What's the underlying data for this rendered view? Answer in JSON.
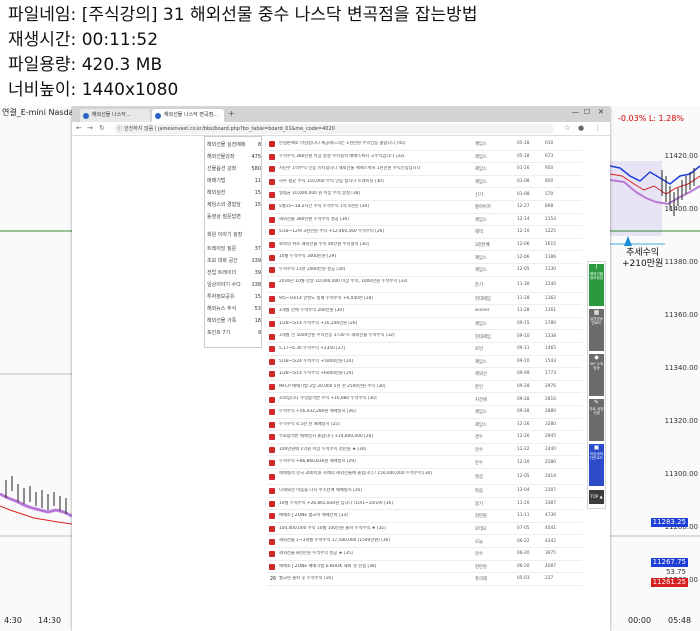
{
  "meta": [
    {
      "key": "파일네임: ",
      "value": "[주식강의] 31 해외선물 중수 나스닥 변곡점을 잡는방법"
    },
    {
      "key": "재생시간: ",
      "value": "00:11:52"
    },
    {
      "key": "파일용량: ",
      "value": "420.3 MB"
    },
    {
      "key": "너비높이: ",
      "value": "1440x1080"
    }
  ],
  "chart": {
    "title": "연결_E-mini Nasdaq100-20",
    "pct_change": "-0.03% L: 1.28%",
    "annotation_line1": "추세수익",
    "annotation_line2": "+210만원",
    "x_labels": [
      "4:30",
      "14:30",
      "00:00",
      "05:48"
    ],
    "y_labels": [
      "11420.00",
      "11400.00",
      "11380.00",
      "11360.00",
      "11340.00",
      "11320.00",
      "11300.00",
      "11280.00",
      "11260.00"
    ],
    "price_boxes": [
      "11283.25",
      "11267.75",
      "53.75",
      "11261.25"
    ],
    "colors": {
      "up": "#1d3fd6",
      "down": "#d42020",
      "band": "#b77ad6"
    }
  },
  "browser": {
    "tab1": "해외선물 나스닥...",
    "tab2": "해외선물 나스닥 변곡점...",
    "url": "jamesinvest.co.kr/bbs/board.php?bo_table=board_01&me_code=4020",
    "url_secure_label": "안전하지 않음"
  },
  "sidebar": {
    "items": [
      {
        "label": "해외선물 실전매매",
        "count": "8"
      },
      {
        "label": "해외선물강좌",
        "count": "475"
      },
      {
        "label": "선물옵션 강좌",
        "count": "580"
      },
      {
        "label": "매매기법",
        "count": "11"
      },
      {
        "label": "해외실전",
        "count": "15"
      },
      {
        "label": "제임스의 경험담",
        "count": "15"
      },
      {
        "label": "동영상 질문답변",
        "count": ""
      },
      {
        "label": "회원 이야기 광장",
        "count": ""
      },
      {
        "label": "트레이딩 질문",
        "count": "37"
      },
      {
        "label": "초보 대화 공간",
        "count": "139"
      },
      {
        "label": "전업 트레이더",
        "count": "39"
      },
      {
        "label": "일상이야기 수다",
        "count": "138"
      },
      {
        "label": "투자정보공유",
        "count": "15"
      },
      {
        "label": "해외뉴스 주식",
        "count": "53"
      },
      {
        "label": "해외선물 가족",
        "count": "18"
      },
      {
        "label": "포인트 7기",
        "count": "9"
      }
    ]
  },
  "posts": [
    {
      "title": "한정판매로 마감합니다 제공해드리는 1천만원 수익인증 올립니다 [45]",
      "author": "제임스",
      "date": "05-18",
      "views": "610"
    },
    {
      "title": "누적수익 380만원 이상 달성 수익실적 매매스펙시 고수익입니다 [33]",
      "author": "제임스",
      "date": "05-18",
      "views": "673"
    },
    {
      "title": "지난주 1억수익 인증 유지합니다 해외선물 매매스펙시 1천만원 수익인증입니다",
      "author": "제임스",
      "date": "01-16",
      "views": "950"
    },
    {
      "title": "하루 평균 수익 110,000 수익 인증 합니다 트레이딩 [30]",
      "author": "제임스",
      "date": "01-08",
      "views": "850"
    },
    {
      "title": "일평균 10,000,000 원 이상 수익 달성 [38]",
      "author": "신기",
      "date": "01-08",
      "views": "570"
    },
    {
      "title": "5월15~18 2시간 수익 누적수익 1억 4천만 [30]",
      "author": "할아버지",
      "date": "12-27",
      "views": "898"
    },
    {
      "title": "해외선물 380만원 누적수익 성공 [36]",
      "author": "제임스",
      "date": "12-14",
      "views": "1154"
    },
    {
      "title": "5/18~12/9 3천만원 수익 +12,460,560 누적수익 [26]",
      "author": "해먹",
      "date": "12-10",
      "views": "1225"
    },
    {
      "title": "화학의 위로 해외선물 수익 40만원 수익실적 [30]",
      "author": "3천만배",
      "date": "12-06",
      "views": "1615"
    },
    {
      "title": "10월 누적수익 3000만원 [29]",
      "author": "제임스",
      "date": "12-06",
      "views": "1186"
    },
    {
      "title": "누적수익 11천 2000만원 성공 [30]",
      "author": "제임스",
      "date": "12-05",
      "views": "1130"
    },
    {
      "title": "2016년 10월 한달 10,000,000 이상 수익, 1000만원 누적수익 [33]",
      "author": "준기",
      "date": "11-30",
      "views": "1240"
    },
    {
      "title": "9/5~10/14 한번도 실패 누적수익 +6,040만 [28]",
      "author": "현대제임",
      "date": "11-28",
      "views": "1362"
    },
    {
      "title": "3개월 만에 누적수익 200만원 [30]",
      "author": "winner",
      "date": "11-28",
      "views": "1361"
    },
    {
      "title": "1/28~5/14 누적수익 +16,206만원 [26]",
      "author": "제임스",
      "date": "09-15",
      "views": "1780"
    },
    {
      "title": "3개월 전 5000만원 수익인증 3730 트 해외선물 누적수익 [32]",
      "author": "현대제임",
      "date": "09-10",
      "views": "1338"
    },
    {
      "title": "5.17~6.30 누적수익 +2350 [27]",
      "author": "로빈",
      "date": "09-11",
      "views": "1465"
    },
    {
      "title": "5/18~5/24 누적수익 +5000만원 [24]",
      "author": "제임스",
      "date": "09-10",
      "views": "1543"
    },
    {
      "title": "1/28~5/14 누적수익 +6000만원 [24]",
      "author": "해외선",
      "date": "09-09",
      "views": "1773"
    },
    {
      "title": "MFCP 매매기법 2일 20,000 5천 천 2500만원 수익 [30]",
      "author": "준인",
      "date": "09-28",
      "views": "2976"
    },
    {
      "title": "초보입니다 우선합격반 수익 +16,880 누적수익 [30]",
      "author": "지전제",
      "date": "09-28",
      "views": "2810"
    },
    {
      "title": "누적수익 +56,432,280원 매매일지 [26]",
      "author": "제임스",
      "date": "09-28",
      "views": "2880"
    },
    {
      "title": "누적수익 4.5천 천 매매일지 [25]",
      "author": "제임스",
      "date": "12-26",
      "views": "3280"
    },
    {
      "title": "무료합격반 매매일지 올립니다 +14,600,000 [26]",
      "author": "경수",
      "date": "12-26",
      "views": "2945"
    },
    {
      "title": "100만원에 1억원 이상 누적수익 천만원 ★ [30]",
      "author": "만수",
      "date": "12-22",
      "views": "2440"
    },
    {
      "title": "누적수익 +86,860,830원 매매일지 [29]",
      "author": "만수",
      "date": "12-20",
      "views": "2580"
    },
    {
      "title": "매매실적 한국 200억원 자체의 해외선물에 올립니다 / 150,000,000 누적수익 [30]",
      "author": "엔샵",
      "date": "12-05",
      "views": "2414"
    },
    {
      "title": "나해외선 마음을 다시 주스턴에 매매실시 [26]",
      "author": "마음",
      "date": "12-04",
      "views": "2307"
    },
    {
      "title": "10월 누적수익 +26,865,830원 입니다 (10/1~10/19) [36]",
      "author": "알기",
      "date": "11-20",
      "views": "3387"
    },
    {
      "title": "매매소 J ZONE 법교이 매매전략 [33]",
      "author": "천만원",
      "date": "11-11",
      "views": "4730"
    },
    {
      "title": "100,000,000 수익 10월 100만원 돌파 누적수익 ★ [35]",
      "author": "로데오",
      "date": "07-05",
      "views": "4041"
    },
    {
      "title": "해외선물 1~3개월 누적수익 17,580,000 (1500만원) [36]",
      "author": "오늘",
      "date": "06-22",
      "views": "4342"
    },
    {
      "title": "해외선물 8천만원 누적수익 성공 ★ [35]",
      "author": "만수",
      "date": "06-20",
      "views": "3975"
    },
    {
      "title": "매매소 J ZONE 매매기법 E-BOOK 해외 첫 선정 [38]",
      "author": "천만원",
      "date": "06-20",
      "views": "4087"
    },
    {
      "title": "월교현 돌파 후 누적수익 [16]",
      "author": "쥬리제",
      "date": "05-03",
      "views": "237"
    }
  ],
  "sidepanel": [
    {
      "icon": "!",
      "label": "해외선물 정보상담"
    },
    {
      "icon": "▦",
      "label": "실전방송 업로드"
    },
    {
      "icon": "◆",
      "label": "VIP 수익방송"
    },
    {
      "icon": "✎",
      "label": "무료 상담신청"
    },
    {
      "icon": "▣",
      "label": "리딩센터 다운로드"
    },
    {
      "icon": "",
      "label": "TOP ▲"
    }
  ]
}
